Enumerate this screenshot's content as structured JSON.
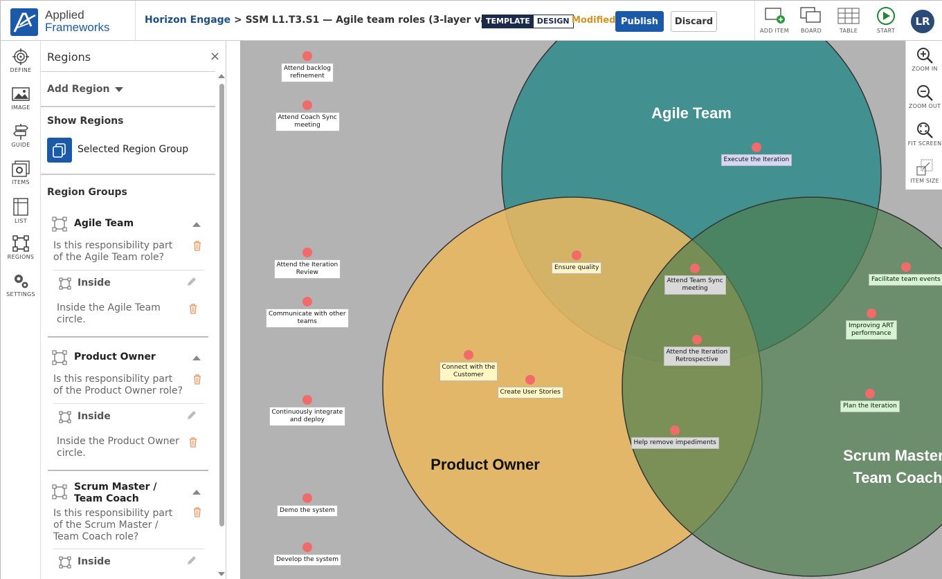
{
  "app": {
    "logo_line1": "Applied",
    "logo_line2": "Frameworks",
    "breadcrumb_link": "Horizon Engage",
    "breadcrumb_sep": " > ",
    "breadcrumb_title": "SSM L1.T3.S1 — Agile team roles (3-layer variant)",
    "mode_template": "TEMPLATE",
    "mode_design": "DESIGN",
    "status": "Modified",
    "publish_label": "Publish",
    "discard_label": "Discard",
    "user_initials": "LR"
  },
  "toolbar": [
    {
      "label": "ADD ITEM",
      "icon": "add-item-icon"
    },
    {
      "label": "BOARD",
      "icon": "board-icon"
    },
    {
      "label": "TABLE",
      "icon": "table-icon"
    },
    {
      "label": "START",
      "icon": "play-icon"
    }
  ],
  "rail": [
    {
      "label": "DEFINE",
      "icon": "target-icon"
    },
    {
      "label": "IMAGE",
      "icon": "image-icon"
    },
    {
      "label": "GUIDE",
      "icon": "signpost-icon"
    },
    {
      "label": "ITEMS",
      "icon": "items-icon"
    },
    {
      "label": "LIST",
      "icon": "list-icon"
    },
    {
      "label": "REGIONS",
      "icon": "regions-icon"
    },
    {
      "label": "SETTINGS",
      "icon": "gears-icon"
    }
  ],
  "panel": {
    "title": "Regions",
    "close": "×",
    "add_region": "Add Region",
    "show_regions": "Show Regions",
    "selected_group": "Selected Region Group",
    "region_groups": "Region Groups",
    "groups": [
      {
        "name": "Agile Team",
        "question": "Is this responsibility part of the Agile Team role?",
        "inside_label": "Inside",
        "inside_desc": "Inside the Agile Team circle."
      },
      {
        "name": "Product Owner",
        "question": "Is this responsibility part of the Product Owner role?",
        "inside_label": "Inside",
        "inside_desc": "Inside the Product Owner circle."
      },
      {
        "name": "Scrum Master / Team Coach",
        "question": "Is this responsibility part of the Scrum Master / Team Coach role?",
        "inside_label": "Inside",
        "inside_desc": ""
      }
    ]
  },
  "zoom_tools": [
    {
      "label": "ZOOM IN",
      "icon": "zoom-in-icon"
    },
    {
      "label": "ZOOM OUT",
      "icon": "zoom-out-icon"
    },
    {
      "label": "FIT SCREEN",
      "icon": "fit-screen-icon"
    },
    {
      "label": "ITEM SIZE",
      "icon": "item-size-icon"
    }
  ],
  "board": {
    "regions": [
      {
        "name": "Agile Team",
        "color": "#2e8a8a"
      },
      {
        "name": "Product Owner",
        "color": "#e8b760"
      },
      {
        "name": "Scrum Master / Team Coach",
        "line1": "Scrum Master /",
        "line2": "Team Coach",
        "color": "#4f7f4f"
      }
    ],
    "items": [
      {
        "label": "Attend backlog refinement",
        "l1": "Attend backlog",
        "l2": "refinement",
        "bg": "#ffffff"
      },
      {
        "label": "Attend Coach Sync meeting",
        "l1": "Attend Coach Sync",
        "l2": "meeting",
        "bg": "#ffffff"
      },
      {
        "label": "Attend the Iteration Review",
        "l1": "Attend the Iteration",
        "l2": "Review",
        "bg": "#ffffff"
      },
      {
        "label": "Communicate with other teams",
        "l1": "Communicate with other",
        "l2": "teams",
        "bg": "#ffffff"
      },
      {
        "label": "Continuously integrate and deploy",
        "l1": "Continuously integrate",
        "l2": "and deploy",
        "bg": "#ffffff"
      },
      {
        "label": "Demo the system",
        "l1": "Demo the system",
        "l2": "",
        "bg": "#ffffff"
      },
      {
        "label": "Develop the system",
        "l1": "Develop the system",
        "l2": "",
        "bg": "#ffffff"
      },
      {
        "label": "Execute the Iteration",
        "l1": "Execute the Iteration",
        "l2": "",
        "bg": "#d5d8f5"
      },
      {
        "label": "Ensure quality",
        "l1": "Ensure quality",
        "l2": "",
        "bg": "#fff3c8"
      },
      {
        "label": "Attend Team Sync meeting",
        "l1": "Attend Team Sync",
        "l2": "meeting",
        "bg": "#d9d9d9"
      },
      {
        "label": "Attend the Iteration Retrospective",
        "l1": "Attend the Iteration",
        "l2": "Retrospective",
        "bg": "#d9d9d9"
      },
      {
        "label": "Connect with the Customer",
        "l1": "Connect with the",
        "l2": "Customer",
        "bg": "#fff6c4"
      },
      {
        "label": "Create User Stories",
        "l1": "Create User Stories",
        "l2": "",
        "bg": "#fff6c4"
      },
      {
        "label": "Help remove impediments",
        "l1": "Help remove impediments",
        "l2": "",
        "bg": "#d9d9d9"
      },
      {
        "label": "Facilitate team events",
        "l1": "Facilitate team events",
        "l2": "",
        "bg": "#d4f5d0"
      },
      {
        "label": "Improving ART performance",
        "l1": "Improving ART",
        "l2": "performance",
        "bg": "#d4f5d0"
      },
      {
        "label": "Plan the Iteration",
        "l1": "Plan the Iteration",
        "l2": "",
        "bg": "#d4f5d0"
      }
    ]
  }
}
